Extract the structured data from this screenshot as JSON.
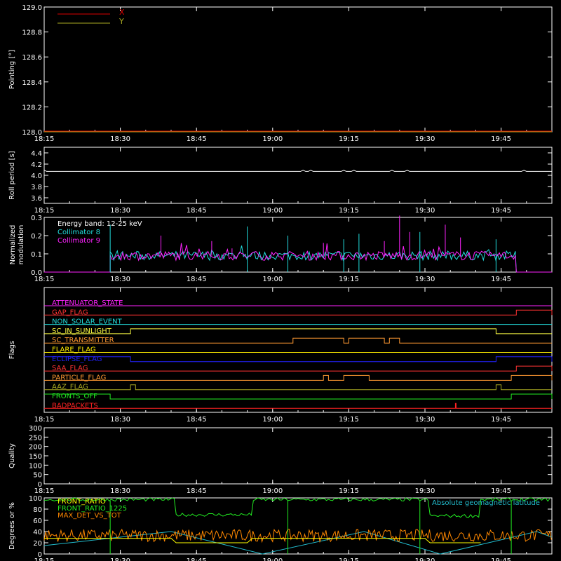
{
  "colors": {
    "background": "#000000",
    "axis": "#ffffff",
    "x_series": "#dd0000",
    "y_series": "#aaaa22",
    "roll": "#ffffff",
    "coll8": "#22dddd",
    "coll9": "#ff22ff",
    "front_ratio": "#ffff00",
    "front_ratio_225": "#22ee22",
    "max_det": "#ff8800",
    "geomag": "#22bbcc"
  },
  "time_axis": {
    "start": "18:15",
    "end": "19:55",
    "tick_labels": [
      "18:15",
      "18:30",
      "18:45",
      "19:00",
      "19:15",
      "19:30",
      "19:45"
    ]
  },
  "chart_data": [
    {
      "id": "pointing",
      "type": "line",
      "ylabel": "Pointing [°]",
      "ylim": [
        128.0,
        129.0
      ],
      "y_ticks": [
        "128.0",
        "128.2",
        "128.4",
        "128.6",
        "128.8",
        "129.0"
      ],
      "legend": [
        {
          "name": "X",
          "color": "#dd0000"
        },
        {
          "name": "Y",
          "color": "#aaaa22"
        }
      ],
      "series": [
        {
          "name": "X",
          "x": [
            "18:15",
            "19:55"
          ],
          "values": [
            128.0,
            128.0
          ]
        },
        {
          "name": "Y",
          "x": [
            "18:15",
            "19:55"
          ],
          "values": [
            128.0,
            128.0
          ]
        }
      ]
    },
    {
      "id": "roll",
      "type": "line",
      "ylabel": "Roll period [s]",
      "ylim": [
        3.5,
        4.5
      ],
      "y_ticks": [
        "3.6",
        "3.8",
        "4.0",
        "4.2",
        "4.4"
      ],
      "series": [
        {
          "name": "",
          "x": [
            "18:15",
            "19:55"
          ],
          "values": [
            4.07,
            4.07
          ]
        }
      ]
    },
    {
      "id": "modulation",
      "type": "line",
      "ylabel": [
        "Normalized",
        "modulation"
      ],
      "ylim": [
        0.0,
        0.3
      ],
      "y_ticks": [
        "0.0",
        "0.1",
        "0.2",
        "0.3"
      ],
      "annotation": "Energy band: 12-25 keV",
      "legend": [
        {
          "name": "Collimator 8",
          "color": "#22dddd"
        },
        {
          "name": "Collimator 9",
          "color": "#ff22ff"
        }
      ],
      "active_range": [
        "18:28",
        "19:48"
      ],
      "baseline": 0.09,
      "spike_times_9": [
        "18:38",
        "18:48",
        "18:52",
        "19:03",
        "19:10",
        "19:22",
        "19:25",
        "19:27",
        "19:34",
        "19:37"
      ],
      "spike_values_9": [
        0.2,
        0.17,
        0.13,
        0.19,
        0.16,
        0.17,
        0.31,
        0.22,
        0.26,
        0.19
      ],
      "spike_times_8": [
        "18:28",
        "18:55",
        "19:03",
        "19:14",
        "19:17",
        "19:29",
        "19:44"
      ],
      "spike_values_8": [
        0.26,
        0.25,
        0.2,
        0.18,
        0.21,
        0.22,
        0.18
      ]
    },
    {
      "id": "flags",
      "type": "line",
      "ylabel": "Flags",
      "flags": [
        {
          "name": "ATTENUATOR_STATE",
          "color": "#ff22ff",
          "high": []
        },
        {
          "name": "GAP_FLAG",
          "color": "#ff3333",
          "high": [
            [
              "19:48",
              "19:55"
            ]
          ]
        },
        {
          "name": "NON_SOLAR_EVENT",
          "color": "#22dddd",
          "high": []
        },
        {
          "name": "SC_IN_SUNLIGHT",
          "color": "#ffff44",
          "high": [
            [
              "18:32",
              "19:44"
            ]
          ]
        },
        {
          "name": "SC_TRANSMITTER",
          "color": "#ff9933",
          "high": [
            [
              "19:04",
              "19:14"
            ],
            [
              "19:15",
              "19:22"
            ],
            [
              "19:23",
              "19:25"
            ]
          ]
        },
        {
          "name": "FLARE_FLAG",
          "color": "#ffee00",
          "high": []
        },
        {
          "name": "ECLIPSE_FLAG",
          "color": "#2222ff",
          "high": [
            [
              "18:15",
              "18:32"
            ],
            [
              "19:44",
              "19:55"
            ]
          ]
        },
        {
          "name": "SAA_FLAG",
          "color": "#ff3333",
          "high": [
            [
              "19:48",
              "19:55"
            ]
          ]
        },
        {
          "name": "PARTICLE_FLAG",
          "color": "#ff9933",
          "high": [
            [
              "19:10",
              "19:11"
            ],
            [
              "19:14",
              "19:19"
            ],
            [
              "19:47",
              "19:55"
            ]
          ]
        },
        {
          "name": "AAZ_FLAG",
          "color": "#aaaa22",
          "high": [
            [
              "18:32",
              "18:33"
            ],
            [
              "19:44",
              "19:45"
            ]
          ]
        },
        {
          "name": "FRONTS_OFF",
          "color": "#22ee22",
          "high": [
            [
              "18:15",
              "18:28"
            ],
            [
              "19:47",
              "19:55"
            ]
          ]
        },
        {
          "name": "BADPACKETS",
          "color": "#ff2222",
          "high": [
            [
              "19:36",
              "19:36"
            ]
          ]
        }
      ]
    },
    {
      "id": "quality",
      "type": "line",
      "ylabel": "Quality",
      "ylim": [
        0,
        300
      ],
      "y_ticks": [
        "0",
        "50",
        "100",
        "150",
        "200",
        "250",
        "300"
      ],
      "series": []
    },
    {
      "id": "ratios",
      "type": "line",
      "ylabel": "Degrees or %",
      "ylim": [
        0,
        100
      ],
      "y_ticks": [
        "0",
        "20",
        "40",
        "60",
        "80",
        "100"
      ],
      "legend": [
        {
          "name": "FRONT_RATIO",
          "color": "#ffff00"
        },
        {
          "name": "FRONT_RATIO_1225",
          "color": "#22ee22"
        },
        {
          "name": "MAX_DET_VS_TOT",
          "color": "#ff8800"
        }
      ],
      "right_label": "Absolute geomagnetic latitude",
      "series": [
        {
          "name": "FRONT_RATIO_1225",
          "x": [
            "18:15",
            "18:40",
            "18:41",
            "18:55",
            "18:56",
            "19:30",
            "19:31",
            "19:40",
            "19:41",
            "19:55"
          ],
          "values": [
            97,
            97,
            70,
            70,
            97,
            97,
            68,
            68,
            97,
            97
          ]
        },
        {
          "name": "FRONT_RATIO",
          "x": [
            "18:15",
            "18:40",
            "18:41",
            "18:55",
            "18:56",
            "19:30",
            "19:31",
            "19:41"
          ],
          "values": [
            28,
            28,
            20,
            20,
            28,
            28,
            20,
            20
          ]
        },
        {
          "name": "MAX_DET_VS_TOT",
          "x": [
            "18:15",
            "19:55"
          ],
          "values": [
            33,
            33
          ]
        },
        {
          "name": "Absolute geomagnetic latitude",
          "x": [
            "18:15",
            "18:40",
            "18:58",
            "19:18",
            "19:33",
            "19:52",
            "19:55"
          ],
          "values": [
            15,
            40,
            0,
            40,
            0,
            40,
            30
          ]
        }
      ]
    }
  ]
}
